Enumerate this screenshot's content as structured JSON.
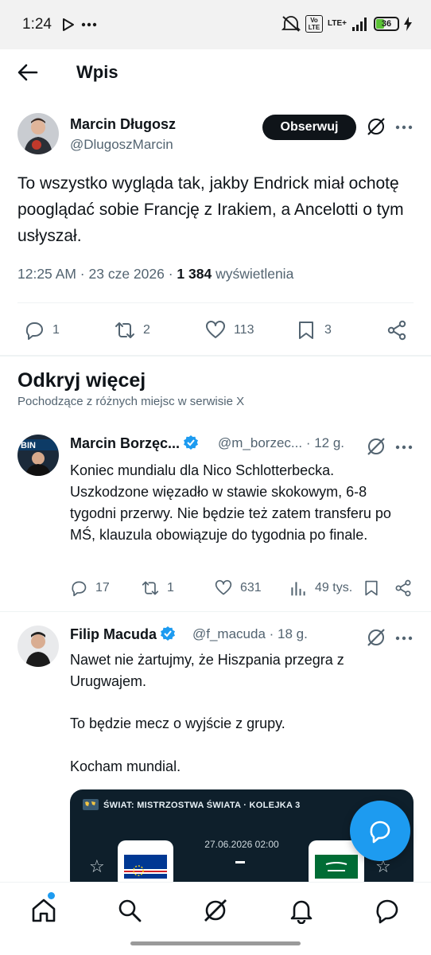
{
  "status_bar": {
    "time": "1:24",
    "network": "LTE+",
    "volte": "Vo LTE",
    "battery": "36",
    "icons": [
      "play-icon",
      "more-dots-icon",
      "mute-icon",
      "signal-icon",
      "charging-icon"
    ]
  },
  "header": {
    "title": "Wpis"
  },
  "main_post": {
    "author": "Marcin Długosz",
    "handle": "@DlugoszMarcin",
    "follow_label": "Obserwuj",
    "text": "To wszystko wygląda tak, jakby Endrick miał ochotę pooglądać sobie Francję z Irakiem, a Ancelotti o tym usłyszał.",
    "time": "12:25 AM · 23 cze 2026 · ",
    "views": "1 384",
    "views_label": " wyświetlenia",
    "replies": "1",
    "reposts": "2",
    "likes": "113",
    "bookmarks": "3"
  },
  "discover": {
    "title": "Odkryj więcej",
    "subtitle": "Pochodzące z różnych miejsc w serwisie X"
  },
  "tweets": [
    {
      "author": "Marcin Borzęc...",
      "handle": "@m_borzec...",
      "time": "· 12 g.",
      "text": "Koniec mundialu dla Nico Schlotterbecka. Uszkodzone więzadło w stawie skokowym, 6-8 tygodni przerwy. Nie będzie też zatem transferu po MŚ, klauzula obowiązuje do tygodnia po finale.",
      "replies": "17",
      "reposts": "1",
      "likes": "631",
      "views": "49 tys."
    },
    {
      "author": "Filip Macuda",
      "handle": "@f_macuda",
      "time": "· 18 g.",
      "text_lines": [
        "Nawet nie żartujmy, że Hiszpania przegra z Urugwajem.",
        "To będzie mecz o wyjście z grupy.",
        "Kocham mundial."
      ],
      "card": {
        "header": "ŚWIAT: MISTRZOSTWA ŚWIATA · KOLEJKA 3",
        "date": "27.06.2026 02:00"
      }
    }
  ],
  "bottom_nav": [
    "home-icon",
    "search-icon",
    "grok-icon",
    "notifications-icon",
    "messages-icon"
  ],
  "colors": {
    "accent": "#1d9bf0",
    "text": "#0f1419",
    "secondary": "#536471",
    "verified": "#1d9bf0"
  }
}
